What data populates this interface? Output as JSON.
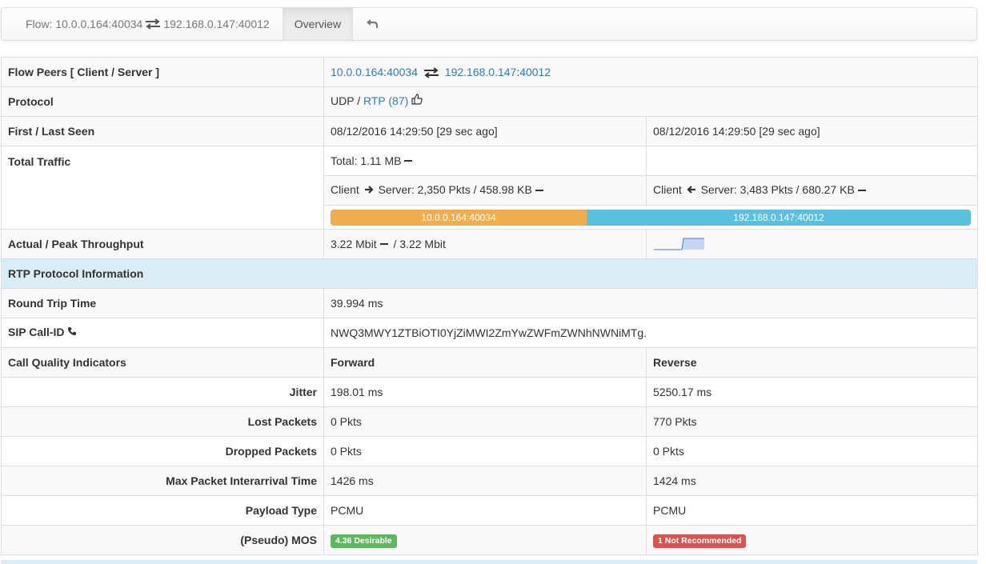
{
  "nav": {
    "flow_prefix": "Flow: ",
    "client": "10.0.0.164:40034",
    "server": "192.168.0.147:40012",
    "overview": "Overview"
  },
  "rows": {
    "peers": {
      "label": "Flow Peers [ Client / Server ]",
      "client_ip": "10.0.0.164",
      "client_port": "40034",
      "server_ip": "192.168.0.147",
      "server_port": "40012",
      "colon": ":"
    },
    "protocol": {
      "label": "Protocol",
      "l4": "UDP",
      "sep": " / ",
      "l7": "RTP (87)"
    },
    "seen": {
      "label": "First / Last Seen",
      "first": "08/12/2016 14:29:50 [29 sec ago]",
      "last": "08/12/2016 14:29:50 [29 sec ago]"
    },
    "traffic": {
      "label": "Total Traffic",
      "total": "Total: 1.11 MB",
      "c2s_prefix": "Client",
      "c2s_suffix": "Server: 2,350 Pkts / 458.98 KB",
      "s2c_prefix": "Client",
      "s2c_suffix": "Server: 3,483 Pkts / 680.27 KB",
      "bar_client_label": "10.0.0.164:40034",
      "bar_server_label": "192.168.0.147:40012",
      "bar_client_fraction": 0.4
    },
    "throughput": {
      "label": "Actual / Peak Throughput",
      "actual": "3.22 Mbit",
      "sep": " / ",
      "peak": "3.22 Mbit"
    },
    "rtp_header": "RTP Protocol Information",
    "rtt": {
      "label": "Round Trip Time",
      "value": "39.994 ms"
    },
    "sip": {
      "label": "SIP Call-ID",
      "value": "NWQ3MWY1ZTBiOTI0YjZiMWI2ZmYwZWFmZWNhNWNiMTg."
    },
    "cqi": {
      "label": "Call Quality Indicators",
      "forward": "Forward",
      "reverse": "Reverse"
    },
    "jitter": {
      "label": "Jitter",
      "forward": "198.01 ms",
      "reverse": "5250.17 ms"
    },
    "lost": {
      "label": "Lost Packets",
      "forward": "0 Pkts",
      "reverse": "770 Pkts"
    },
    "dropped": {
      "label": "Dropped Packets",
      "forward": "0 Pkts",
      "reverse": "0 Pkts"
    },
    "interarrival": {
      "label": "Max Packet Interarrival Time",
      "forward": "1426 ms",
      "reverse": "1424 ms"
    },
    "payload": {
      "label": "Payload Type",
      "forward": "PCMU",
      "reverse": "PCMU"
    },
    "mos": {
      "label": "(Pseudo) MOS",
      "forward": "4.36 Desirable",
      "reverse": "1 Not Recommended"
    }
  },
  "colors": {
    "link": "#337ab7",
    "client_bar": "#f0ad4e",
    "server_bar": "#5bc0de",
    "section_bg": "#d9edf7",
    "success": "#5cb85c",
    "danger": "#d9534f"
  },
  "icons": [
    "exchange-icon",
    "undo-icon",
    "thumbs-up-icon",
    "arrow-right-icon",
    "arrow-left-icon",
    "phone-icon",
    "minus-icon"
  ]
}
